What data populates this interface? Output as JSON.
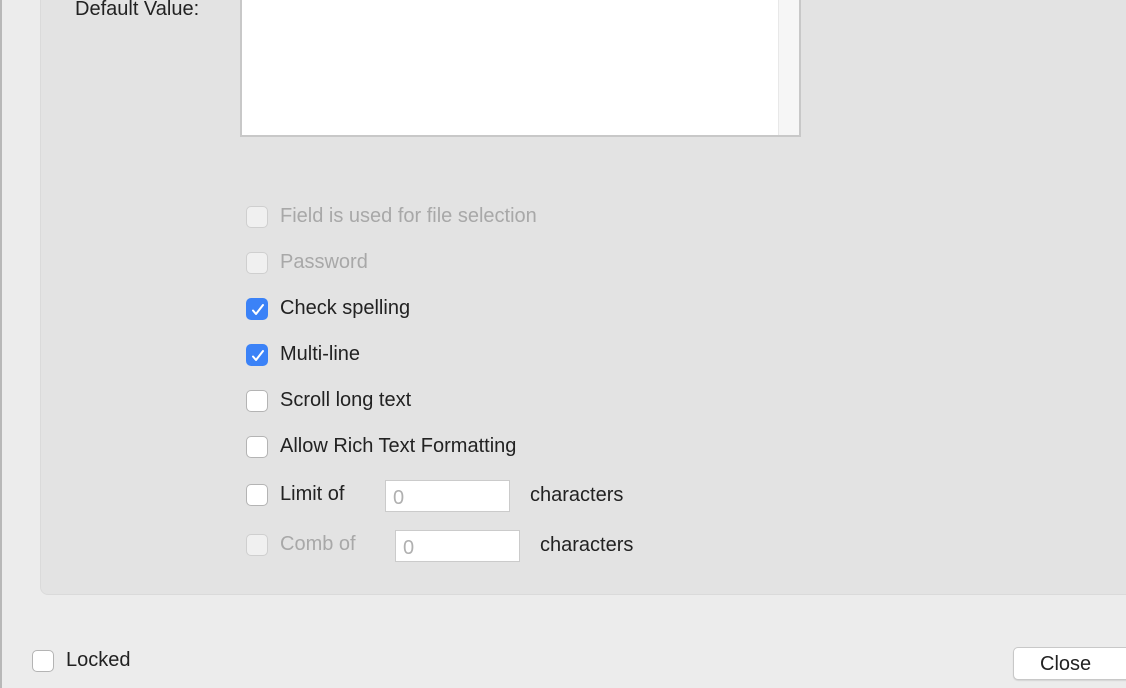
{
  "default_value": {
    "label": "Default Value:",
    "value": ""
  },
  "options": [
    {
      "label": "Field is used for file selection",
      "checked": false,
      "enabled": false
    },
    {
      "label": "Password",
      "checked": false,
      "enabled": false
    },
    {
      "label": "Check spelling",
      "checked": true,
      "enabled": true
    },
    {
      "label": "Multi-line",
      "checked": true,
      "enabled": true
    },
    {
      "label": "Scroll long text",
      "checked": false,
      "enabled": true
    },
    {
      "label": "Allow Rich Text Formatting",
      "checked": false,
      "enabled": true
    }
  ],
  "limit": {
    "label": "Limit of",
    "value": "0",
    "suffix": "characters",
    "checked": false,
    "enabled": true
  },
  "comb": {
    "label": "Comb of",
    "value": "0",
    "suffix": "characters",
    "checked": false,
    "enabled": false
  },
  "locked": {
    "label": "Locked",
    "checked": false
  },
  "close_label": "Close",
  "accent_color": "#3b82f7"
}
